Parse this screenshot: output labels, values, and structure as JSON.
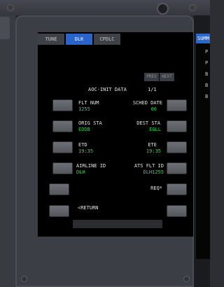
{
  "tabs": [
    {
      "label": "TUNE",
      "active": false
    },
    {
      "label": "DLK",
      "active": true
    },
    {
      "label": "CPDLC",
      "active": false
    }
  ],
  "paging": {
    "prev": "PREV",
    "next": "NEXT"
  },
  "page": {
    "title": "AOC-INIT DATA",
    "page_number": "1/1"
  },
  "fields": {
    "flt_num": {
      "label": "FLT NUM",
      "value": "1255"
    },
    "sched_date": {
      "label": "SCHED DATE",
      "value": "06"
    },
    "orig_sta": {
      "label": "ORIG STA",
      "value": "EDDB"
    },
    "dest_sta": {
      "label": "DEST STA",
      "value": "EGLL"
    },
    "etd": {
      "label": "ETD",
      "value": "19:35"
    },
    "ete": {
      "label": "ETE",
      "value": "19:35"
    },
    "airline_id": {
      "label": "AIRLINE ID",
      "value": "DLH"
    },
    "ats_flt_id": {
      "label": "ATS FLT ID",
      "value": "DLH1255"
    }
  },
  "actions": {
    "req": "REQ*",
    "return": "<RETURN"
  },
  "side_panel": {
    "header": "SUMM",
    "letters": [
      "P",
      "P",
      "B",
      "B",
      "B"
    ]
  },
  "colors": {
    "active_tab": "#2a63c9",
    "data_value": "#2fd44a",
    "label": "#e4e4e4",
    "screen": "#000000"
  }
}
